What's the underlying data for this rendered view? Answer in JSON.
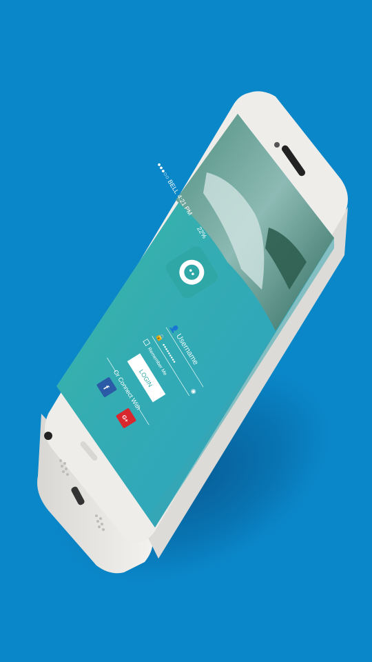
{
  "status_bar": {
    "carrier": "●●●○○ BELL",
    "time": "4:21 PM",
    "battery": "22%"
  },
  "login": {
    "username_placeholder": "Username",
    "password_mask": "●●●●●●●●●",
    "remember_label": "Remember Me",
    "login_button": "LOGIN",
    "connect_label": "Or Connect With"
  },
  "social": {
    "facebook_icon": "f",
    "google_icon": "G+"
  },
  "colors": {
    "background": "#0a87c9",
    "screen_top": "#3fb9a6",
    "screen_bottom": "#2aa0c4",
    "facebook": "#2b5aa6",
    "google": "#d9272e",
    "phone_frame": "#eeedea"
  }
}
